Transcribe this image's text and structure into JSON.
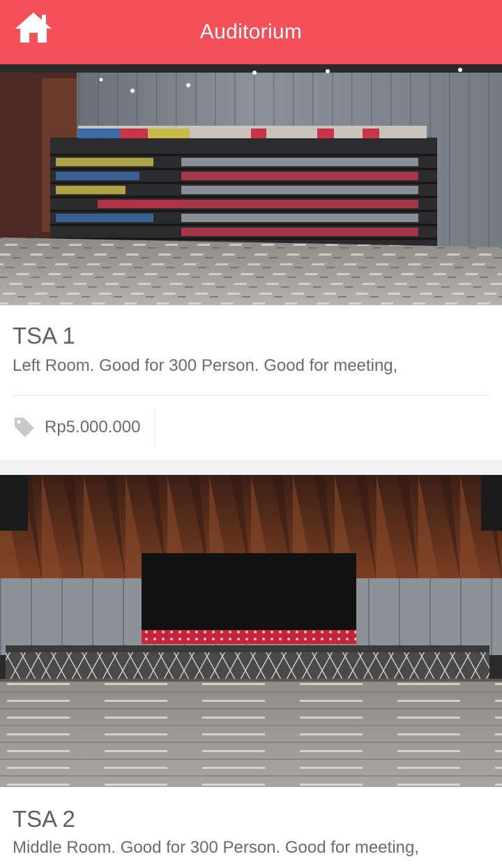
{
  "header": {
    "title": "Auditorium",
    "home_icon": "home-icon",
    "background": "#f5505a"
  },
  "rooms": [
    {
      "name": "TSA 1",
      "description": "Left Room. Good for 300 Person. Good for meeting,",
      "price": "Rp5.000.000",
      "price_icon": "tag-icon"
    },
    {
      "name": "TSA 2",
      "description": "Middle Room. Good for 300 Person. Good for meeting,"
    }
  ]
}
